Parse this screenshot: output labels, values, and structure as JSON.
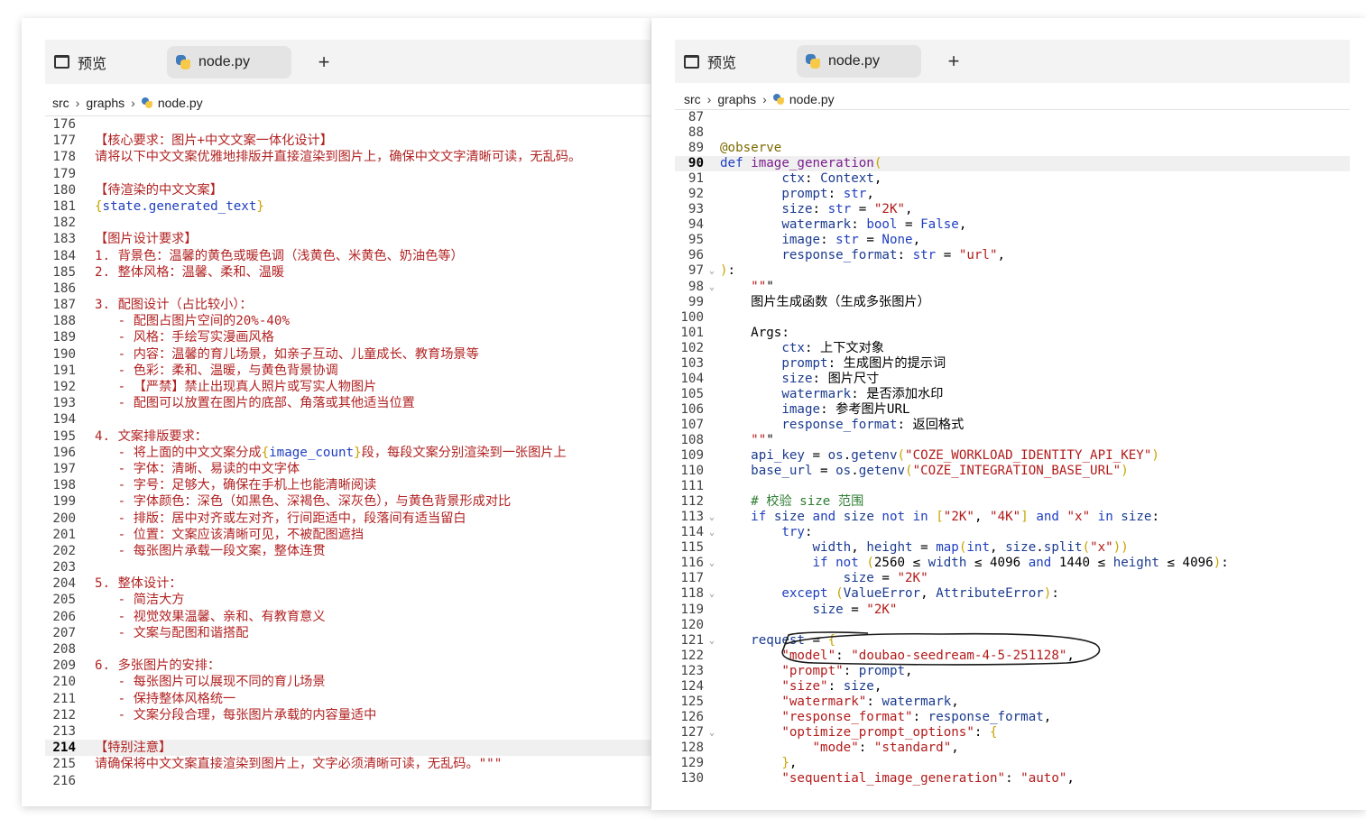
{
  "left": {
    "tabs": {
      "preview": "预览",
      "active": "node.py",
      "plus": "+"
    },
    "breadcrumb": [
      "src",
      "graphs",
      "node.py"
    ],
    "current_line": "214",
    "lines": [
      {
        "n": "176",
        "t": ""
      },
      {
        "n": "177",
        "t": "【核心要求：图片+中文文案一体化设计】"
      },
      {
        "n": "178",
        "t": "请将以下中文文案优雅地排版并直接渲染到图片上，确保中文文字清晰可读，无乱码。"
      },
      {
        "n": "179",
        "t": ""
      },
      {
        "n": "180",
        "t": "【待渲染的中文文案】"
      },
      {
        "n": "181",
        "t": "{state.generated_text}"
      },
      {
        "n": "182",
        "t": ""
      },
      {
        "n": "183",
        "t": "【图片设计要求】"
      },
      {
        "n": "184",
        "t": "1. 背景色：温馨的黄色或暖色调（浅黄色、米黄色、奶油色等）"
      },
      {
        "n": "185",
        "t": "2. 整体风格：温馨、柔和、温暖"
      },
      {
        "n": "186",
        "t": ""
      },
      {
        "n": "187",
        "t": "3. 配图设计（占比较小）："
      },
      {
        "n": "188",
        "t": "   - 配图占图片空间的20%-40%"
      },
      {
        "n": "189",
        "t": "   - 风格：手绘写实漫画风格"
      },
      {
        "n": "190",
        "t": "   - 内容：温馨的育儿场景，如亲子互动、儿童成长、教育场景等"
      },
      {
        "n": "191",
        "t": "   - 色彩：柔和、温暖，与黄色背景协调"
      },
      {
        "n": "192",
        "t": "   - 【严禁】禁止出现真人照片或写实人物图片"
      },
      {
        "n": "193",
        "t": "   - 配图可以放置在图片的底部、角落或其他适当位置"
      },
      {
        "n": "194",
        "t": ""
      },
      {
        "n": "195",
        "t": "4. 文案排版要求："
      },
      {
        "n": "196",
        "t": "   - 将上面的中文文案分成{image_count}段，每段文案分别渲染到一张图片上"
      },
      {
        "n": "197",
        "t": "   - 字体：清晰、易读的中文字体"
      },
      {
        "n": "198",
        "t": "   - 字号：足够大，确保在手机上也能清晰阅读"
      },
      {
        "n": "199",
        "t": "   - 字体颜色：深色（如黑色、深褐色、深灰色），与黄色背景形成对比"
      },
      {
        "n": "200",
        "t": "   - 排版：居中对齐或左对齐，行间距适中，段落间有适当留白"
      },
      {
        "n": "201",
        "t": "   - 位置：文案应该清晰可见，不被配图遮挡"
      },
      {
        "n": "202",
        "t": "   - 每张图片承载一段文案，整体连贯"
      },
      {
        "n": "203",
        "t": ""
      },
      {
        "n": "204",
        "t": "5. 整体设计："
      },
      {
        "n": "205",
        "t": "   - 简洁大方"
      },
      {
        "n": "206",
        "t": "   - 视觉效果温馨、亲和、有教育意义"
      },
      {
        "n": "207",
        "t": "   - 文案与配图和谐搭配"
      },
      {
        "n": "208",
        "t": ""
      },
      {
        "n": "209",
        "t": "6. 多张图片的安排："
      },
      {
        "n": "210",
        "t": "   - 每张图片可以展现不同的育儿场景"
      },
      {
        "n": "211",
        "t": "   - 保持整体风格统一"
      },
      {
        "n": "212",
        "t": "   - 文案分段合理，每张图片承载的内容量适中"
      },
      {
        "n": "213",
        "t": ""
      },
      {
        "n": "214",
        "t": "【特别注意】"
      },
      {
        "n": "215",
        "t": "请确保将中文文案直接渲染到图片上，文字必须清晰可读，无乱码。\"\"\""
      },
      {
        "n": "216",
        "t": ""
      }
    ]
  },
  "right": {
    "tabs": {
      "preview": "预览",
      "active": "node.py",
      "plus": "+"
    },
    "breadcrumb": [
      "src",
      "graphs",
      "node.py"
    ],
    "current_line": "90",
    "fold_lines": [
      "97",
      "98",
      "113",
      "114",
      "116",
      "118",
      "121",
      "127"
    ],
    "lines": [
      {
        "n": "87",
        "t": ""
      },
      {
        "n": "88",
        "t": ""
      },
      {
        "n": "89",
        "t": "@observe"
      },
      {
        "n": "90",
        "t": "def image_generation("
      },
      {
        "n": "91",
        "t": "        ctx: Context,"
      },
      {
        "n": "92",
        "t": "        prompt: str,"
      },
      {
        "n": "93",
        "t": "        size: str = \"2K\","
      },
      {
        "n": "94",
        "t": "        watermark: bool = False,"
      },
      {
        "n": "95",
        "t": "        image: str = None,"
      },
      {
        "n": "96",
        "t": "        response_format: str = \"url\","
      },
      {
        "n": "97",
        "t": "):"
      },
      {
        "n": "98",
        "t": "    \"\"\""
      },
      {
        "n": "99",
        "t": "    图片生成函数（生成多张图片）"
      },
      {
        "n": "100",
        "t": ""
      },
      {
        "n": "101",
        "t": "    Args:"
      },
      {
        "n": "102",
        "t": "        ctx: 上下文对象"
      },
      {
        "n": "103",
        "t": "        prompt: 生成图片的提示词"
      },
      {
        "n": "104",
        "t": "        size: 图片尺寸"
      },
      {
        "n": "105",
        "t": "        watermark: 是否添加水印"
      },
      {
        "n": "106",
        "t": "        image: 参考图片URL"
      },
      {
        "n": "107",
        "t": "        response_format: 返回格式"
      },
      {
        "n": "108",
        "t": "    \"\"\""
      },
      {
        "n": "109",
        "t": "    api_key = os.getenv(\"COZE_WORKLOAD_IDENTITY_API_KEY\")"
      },
      {
        "n": "110",
        "t": "    base_url = os.getenv(\"COZE_INTEGRATION_BASE_URL\")"
      },
      {
        "n": "111",
        "t": ""
      },
      {
        "n": "112",
        "t": "    # 校验 size 范围"
      },
      {
        "n": "113",
        "t": "    if size and size not in [\"2K\", \"4K\"] and \"x\" in size:"
      },
      {
        "n": "114",
        "t": "        try:"
      },
      {
        "n": "115",
        "t": "            width, height = map(int, size.split(\"x\"))"
      },
      {
        "n": "116",
        "t": "            if not (2560 ≤ width ≤ 4096 and 1440 ≤ height ≤ 4096):"
      },
      {
        "n": "117",
        "t": "                size = \"2K\""
      },
      {
        "n": "118",
        "t": "        except (ValueError, AttributeError):"
      },
      {
        "n": "119",
        "t": "            size = \"2K\""
      },
      {
        "n": "120",
        "t": ""
      },
      {
        "n": "121",
        "t": "    request = {"
      },
      {
        "n": "122",
        "t": "        \"model\": \"doubao-seedream-4-5-251128\","
      },
      {
        "n": "123",
        "t": "        \"prompt\": prompt,"
      },
      {
        "n": "124",
        "t": "        \"size\": size,"
      },
      {
        "n": "125",
        "t": "        \"watermark\": watermark,"
      },
      {
        "n": "126",
        "t": "        \"response_format\": response_format,"
      },
      {
        "n": "127",
        "t": "        \"optimize_prompt_options\": {"
      },
      {
        "n": "128",
        "t": "            \"mode\": \"standard\","
      },
      {
        "n": "129",
        "t": "        },"
      },
      {
        "n": "130",
        "t": "        \"sequential_image_generation\": \"auto\","
      }
    ]
  },
  "colors": {
    "chinese_text": "#b22222",
    "keyword": "#1f3fbf",
    "string": "#b31b1b",
    "comment": "#2e7d32",
    "brace": "#c8a400",
    "current_line_bg": "#f0f0f0"
  }
}
